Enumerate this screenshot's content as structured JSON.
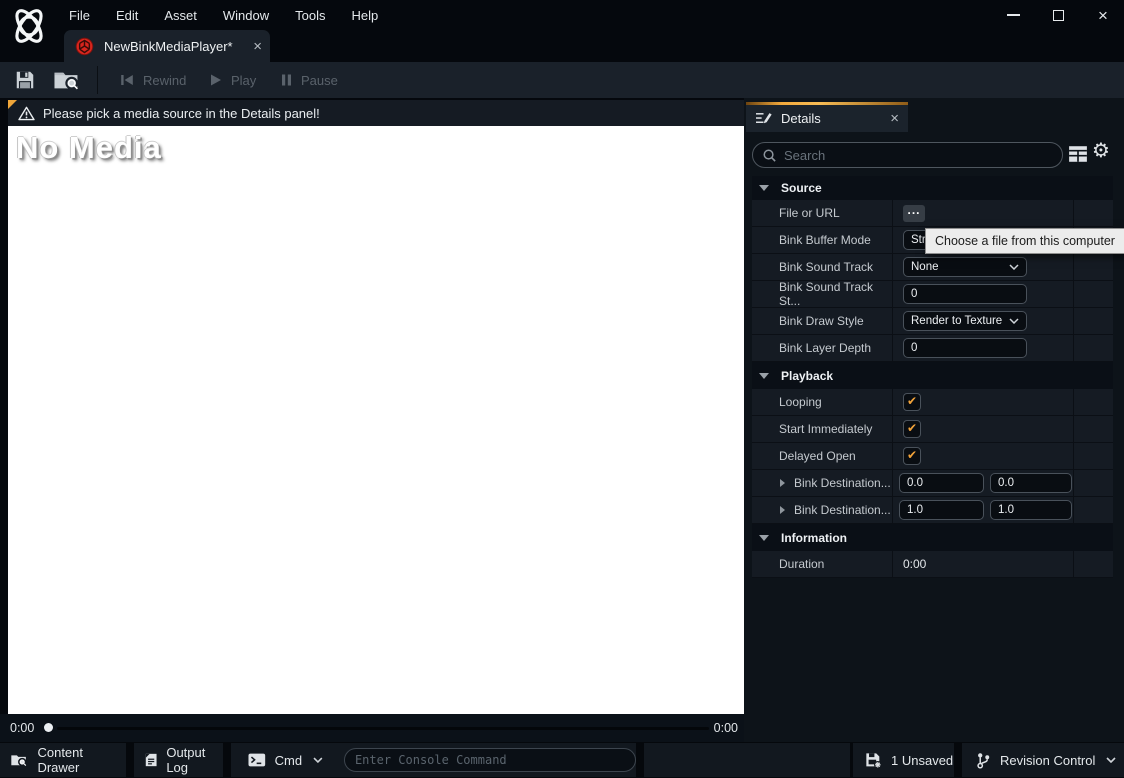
{
  "titlebar": {
    "menu": [
      "File",
      "Edit",
      "Asset",
      "Window",
      "Tools",
      "Help"
    ]
  },
  "asset_tab": {
    "title": "NewBinkMediaPlayer*"
  },
  "toolbar": {
    "rewind_label": "Rewind",
    "play_label": "Play",
    "pause_label": "Pause"
  },
  "viewport": {
    "warning_message": "Please pick a media source in the Details panel!",
    "placeholder_title": "No Media",
    "timeline": {
      "current_time": "0:00",
      "total_time": "0:00"
    }
  },
  "details": {
    "tab_title": "Details",
    "search_placeholder": "Search",
    "tooltip": "Choose a file from this computer",
    "source": {
      "title": "Source",
      "file_or_url": {
        "label": "File or URL",
        "browse_button": "..."
      },
      "buffer_mode": {
        "label": "Bink Buffer Mode",
        "value": "Str"
      },
      "sound_track": {
        "label": "Bink Sound Track",
        "value": "None"
      },
      "sound_track_start": {
        "label": "Bink Sound Track St...",
        "value": "0"
      },
      "draw_style": {
        "label": "Bink Draw Style",
        "value": "Render to Texture"
      },
      "layer_depth": {
        "label": "Bink Layer Depth",
        "value": "0"
      }
    },
    "playback": {
      "title": "Playback",
      "looping": {
        "label": "Looping",
        "checked": true
      },
      "start_immediately": {
        "label": "Start Immediately",
        "checked": true
      },
      "delayed_open": {
        "label": "Delayed Open",
        "checked": true
      },
      "destination_upper_left": {
        "label": "Bink Destination...",
        "x": "0.0",
        "y": "0.0"
      },
      "destination_lower_right": {
        "label": "Bink Destination...",
        "x": "1.0",
        "y": "1.0"
      }
    },
    "information": {
      "title": "Information",
      "duration": {
        "label": "Duration",
        "value": "0:00"
      }
    }
  },
  "status_bar": {
    "content_drawer_label": "Content Drawer",
    "output_log_label": "Output Log",
    "cmd_label": "Cmd",
    "console_placeholder": "Enter Console Command",
    "unsaved_label": "1 Unsaved",
    "revision_control_label": "Revision Control"
  },
  "icons": {
    "close_glyph": "×",
    "check_glyph": "✔",
    "gear_glyph": "⚙"
  },
  "colors": {
    "accent_orange": "#F2A93C",
    "checkbox_check": "#F2A33A",
    "bink_red": "#D8261E",
    "tooltip_bg": "#ECECEC",
    "viewport_bg": "#FFFFFF",
    "panel_bg": "#0D1319",
    "row_bg": "#151B23"
  }
}
